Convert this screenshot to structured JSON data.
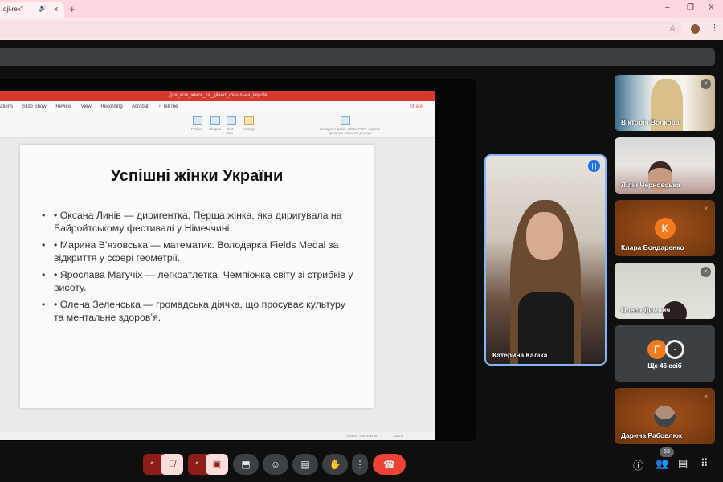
{
  "browser": {
    "tab_title": "qji-rek\"",
    "new_tab": "+",
    "minimize": "–",
    "restore": "❐",
    "close": "X",
    "tab_close": "x",
    "tab_sound": "🔊",
    "bookmark": "☆",
    "menu": "⋮"
  },
  "ppt": {
    "filename": "Для_всіх_жінок_та_дівчат_фінальна_версія",
    "ribbon_tabs": [
      "ations",
      "Slide Show",
      "Review",
      "View",
      "Recording",
      "Acrobat",
      "♀ Tell me"
    ],
    "share": "Share",
    "ribbon_labels": {
      "picture": "Picture",
      "shapes": "Shapes",
      "textbox": "Text Box",
      "arrange": "Arrange",
      "acrobat": "Створити файл Adobe PDF і надати до нього спільний доступ"
    },
    "status": {
      "notes": "Notes",
      "comments": "Comments",
      "zoom": "150%"
    }
  },
  "slide": {
    "title": "Успішні жінки України",
    "bullets": [
      "• Оксана Линів — диригентка. Перша жінка, яка диригувала на Байройтському фестивалі у Німеччині.",
      "• Марина В’язовська — математик. Володарка Fields Medal за відкриття у сфері геометрії.",
      "• Ярослава Магучіх — легкоатлетка. Чемпіонка світу зі стрибків у висоту.",
      "• Олена Зеленська — громадська діячка, що просуває культуру та ментальне здоров’я."
    ]
  },
  "speaker": {
    "name": "Катерина Каліка"
  },
  "participants": [
    {
      "name": "Вікторія Волкова",
      "muted": true
    },
    {
      "name": "Лілія Черновська",
      "muted": false
    },
    {
      "name": "Клара Бондаренко",
      "initial": "К",
      "muted": true
    },
    {
      "name": "Олеся Димнич",
      "muted": true
    },
    {
      "more_label": "Ще 46 осіб",
      "initial": "Г"
    },
    {
      "name": "Дарина Рабовлюк",
      "muted": true
    }
  ],
  "controls": {
    "participant_count": "53"
  },
  "colors": {
    "accent": "#8ab4f8",
    "end_call": "#ea4335",
    "ppt_red": "#d63a2b"
  }
}
